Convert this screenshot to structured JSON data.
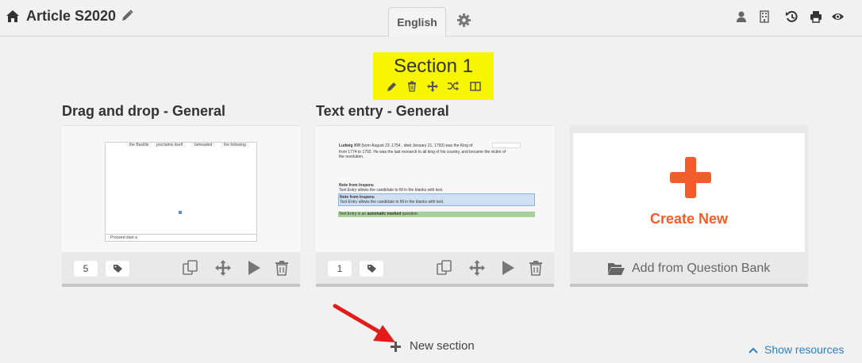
{
  "header": {
    "title": "Article S2020",
    "language_tab": "English",
    "icons": [
      "home-icon",
      "pencil-icon",
      "gear-icon",
      "user-icon",
      "building-icon",
      "history-icon",
      "print-icon",
      "eye-icon"
    ]
  },
  "section": {
    "title": "Section 1",
    "highlight_color": "#f8f500",
    "tools": [
      "pencil-icon",
      "trash-icon",
      "move-icon",
      "shuffle-icon",
      "columns-icon"
    ]
  },
  "cards": [
    {
      "title": "Drag and drop - General",
      "count": "5",
      "thumbnail": {
        "words": [
          "the Bastille",
          "proclaims itself",
          "beheaded",
          "the following"
        ],
        "footer": "Proceed start a"
      }
    },
    {
      "title": "Text entry - General",
      "count": "1",
      "thumbnail": {
        "line1a": "Ludwig XVI",
        "line1b": "(born August 23 ,1754 , died January 21, 1793) was the King of",
        "line2": "from 1774 to 1792. He was the last monarch to all king of his country, and became the victim of",
        "line3": "the revolution.",
        "note_title": "Note from Inspera:",
        "note_text_em": "Text Entry",
        "note_text": "allows the candidate to fill in the blanks with text.",
        "box_title": "Note from Inspera:",
        "box_text_em": "Text Entry",
        "box_text": "allows the candidate to fill in the blanks with text.",
        "green_pre": "Text Entry is an",
        "green_bold": "automatic marked",
        "green_post": "question."
      }
    }
  ],
  "create_card": {
    "label": "Create New",
    "bank_label": "Add from Question Bank",
    "accent_color": "#f25d2a"
  },
  "footer": {
    "new_section": "New section",
    "show_resources": "Show resources",
    "link_color": "#2d7fc4",
    "arrow_color": "#e31b1b"
  }
}
